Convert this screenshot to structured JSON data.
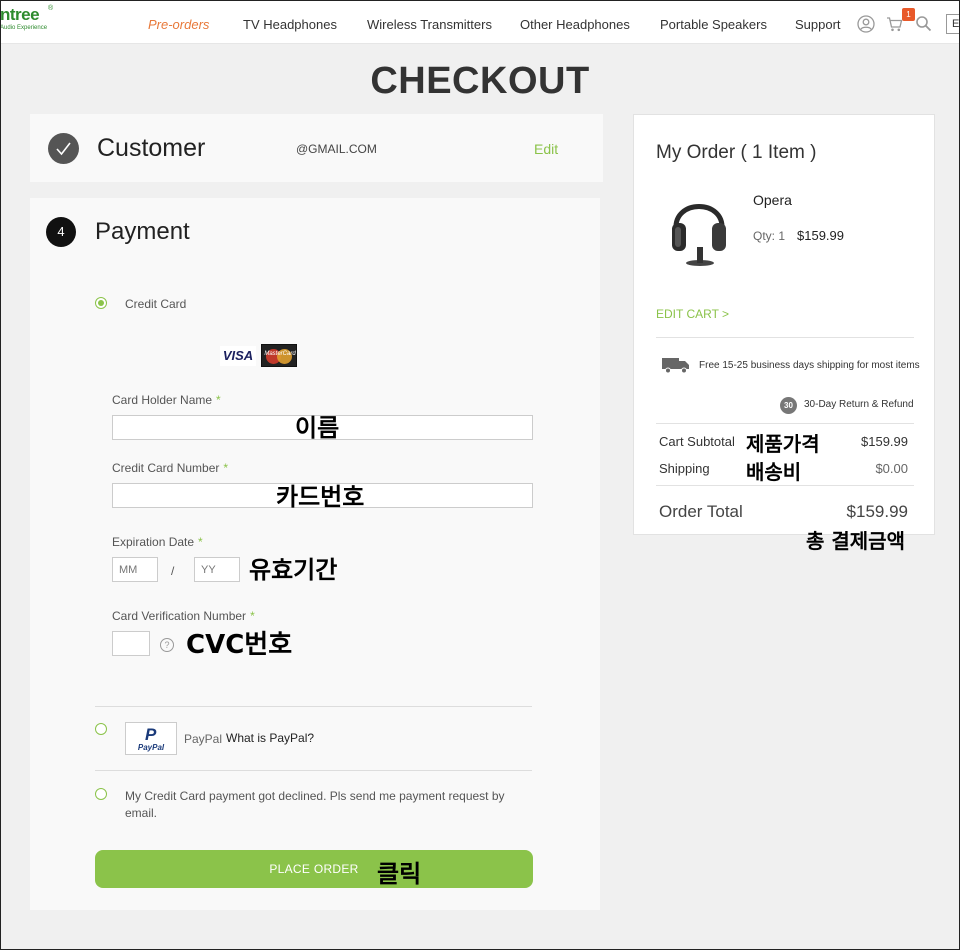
{
  "header": {
    "logo_main": "ntree",
    "logo_reg": "®",
    "logo_sub": "Audio Experience",
    "nav": [
      "Pre-orders",
      "TV Headphones",
      "Wireless Transmitters",
      "Other Headphones",
      "Portable Speakers",
      "Support"
    ],
    "cart_count": "1",
    "lang": "E",
    "icons": [
      "account-icon",
      "cart-icon",
      "search-icon"
    ]
  },
  "page_title": "CHECKOUT",
  "customer": {
    "title": "Customer",
    "email": "@GMAIL.COM",
    "edit_label": "Edit"
  },
  "payment": {
    "step": "4",
    "title": "Payment",
    "credit_card_label": "Credit Card",
    "card_brands": [
      "VISA",
      "MasterCard"
    ],
    "card_holder_label": "Card Holder Name",
    "card_number_label": "Credit Card Number",
    "expiration_label": "Expiration Date",
    "month_placeholder": "MM",
    "year_placeholder": "YY",
    "separator": "/",
    "cvn_label": "Card Verification Number",
    "help_glyph": "?",
    "required_mark": "*",
    "paypal_logo_top": "P",
    "paypal_logo_word": "PayPal",
    "paypal_label": "PayPal",
    "paypal_what": "What is PayPal?",
    "declined_text": "My Credit Card payment got declined. Pls send me payment request by email.",
    "place_order_label": "PLACE ORDER"
  },
  "annotations": {
    "name": "이름",
    "card_number": "카드번호",
    "expiry": "유효기간",
    "cvc": "CVC번호",
    "click": "클릭",
    "product_price": "제품가격",
    "shipping_cost": "배송비",
    "total_payment": "총 결제금액"
  },
  "order": {
    "title": "My Order ( 1 Item )",
    "product_name": "Opera",
    "product_qty": "Qty: 1",
    "product_price": "$159.99",
    "edit_cart": "EDIT CART >",
    "shipping_note": "Free 15-25 business days shipping for most items",
    "return_badge": "30",
    "return_note": "30-Day Return & Refund",
    "subtotal_label": "Cart Subtotal",
    "subtotal_value": "$159.99",
    "shipping_label": "Shipping",
    "shipping_value": "$0.00",
    "total_label": "Order Total",
    "total_value": "$159.99"
  },
  "colors": {
    "accent_green": "#8bc34a",
    "nav_active": "#e8793a",
    "badge": "#e8592a"
  }
}
